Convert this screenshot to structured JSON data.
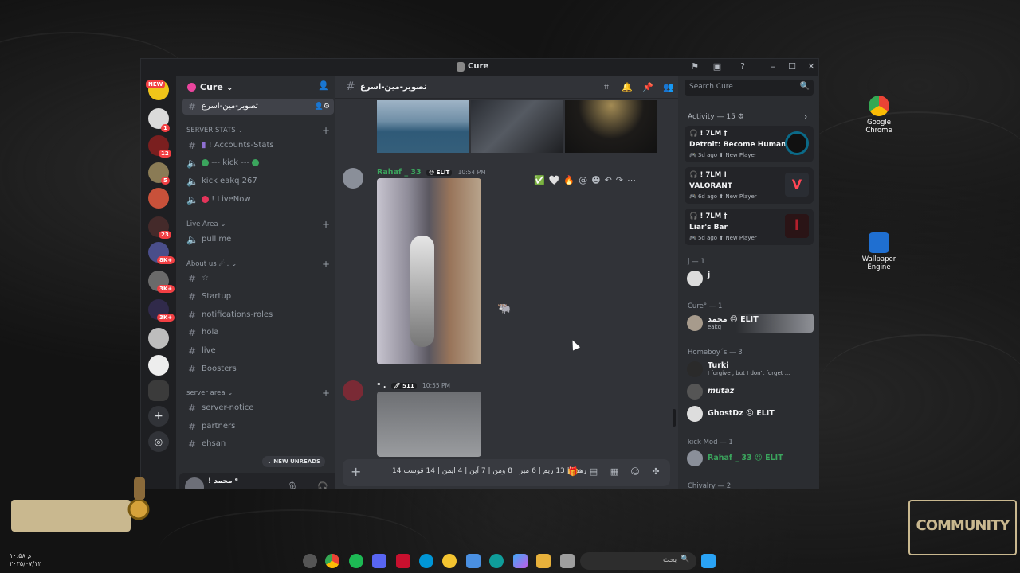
{
  "window": {
    "title": "Cure"
  },
  "guild": {
    "name": "Cure ⌄"
  },
  "rail": {
    "new_badge": "NEW",
    "badges": [
      "1",
      "12",
      "5",
      "23",
      "8K+",
      "3K+",
      "3K+"
    ]
  },
  "channels": {
    "active": "تصوير-مين-اسرع",
    "server_stats_cat": "SERVER STATS ⌄",
    "stats": [
      {
        "icon": "text-icon",
        "label": "! Accounts-Stats"
      },
      {
        "icon": "speaker-icon",
        "label": "--- kick ---"
      },
      {
        "icon": "speaker-icon",
        "label": "kick eakq 267"
      },
      {
        "icon": "speaker-icon",
        "label": "! LiveNow"
      }
    ],
    "live_area_cat": "Live Area ⌄",
    "live": [
      {
        "label": "pull me"
      }
    ],
    "about_cat": "About us ☄ . ⌄",
    "about": [
      "☆",
      "Startup",
      "notifications-roles",
      "hola",
      "live",
      "Boosters"
    ],
    "server_area_cat": "server area ⌄",
    "server_area": [
      "server-notice",
      "partners",
      "ehsan"
    ],
    "new_unreads": "⌄ NEW UNREADS"
  },
  "user_panel": {
    "name": "! محمد ᵉ",
    "status": "eakq"
  },
  "chat": {
    "channel_name": "تصوير-مين-اسرع",
    "msg1": {
      "author": "Rahaf _ 33",
      "tag": "😠 ELIT",
      "time": "10:54 PM"
    },
    "msg2": {
      "author": "ᵉ .",
      "tag": "🖊 511",
      "time": "10:55 PM"
    },
    "toolbar": [
      "✅",
      "🤍",
      "🔥",
      "@",
      "☻",
      "↶",
      "↷",
      "⋯"
    ],
    "composer_text": "14 رهف | 13 ريم | 6 ميز | 8 ومن | 7 آين | 4 ايمن | 14 قوست"
  },
  "right": {
    "search_placeholder": "Search Cure",
    "activity_head": "Activity — 15 ⚙",
    "activities": [
      {
        "who": "🎧 ! 7LM †",
        "game": "Detroit: Become Human",
        "meta": "🎮 3d ago  ⬆ New Player",
        "color": "#0b6a88"
      },
      {
        "who": "🎧 ! 7LM †",
        "game": "VALORANT",
        "meta": "🎮 6d ago  ⬆ New Player",
        "color": "#ff4655"
      },
      {
        "who": "🎧 ! 7LM †",
        "game": "Liar's Bar",
        "meta": "🎮 5d ago  ⬆ New Player",
        "color": "#b51f2c"
      }
    ],
    "groups": [
      {
        "label": "j — 1",
        "members": [
          {
            "name": "j",
            "sub": ""
          }
        ]
      },
      {
        "label": "Cure° — 1",
        "members": [
          {
            "name": "محمد 😠 ELIT",
            "sub": "eakq"
          }
        ]
      },
      {
        "label": "Homeboy´s — 3",
        "members": [
          {
            "name": "Turki",
            "sub": "I forgive , but I don't forget ..."
          },
          {
            "name": "mutaz",
            "sub": ""
          },
          {
            "name": "GhostDz 😠 ELIT",
            "sub": ""
          }
        ]
      },
      {
        "label": "kick Mod — 1",
        "members": [
          {
            "name": "Rahaf _ 33 😠 ELIT",
            "sub": ""
          }
        ]
      },
      {
        "label": "Chivalry — 2",
        "members": []
      }
    ]
  },
  "desktop": {
    "icons": [
      {
        "label": "Google Chrome"
      },
      {
        "label": "Wallpaper Engine"
      }
    ],
    "taskbar_search": "بحث",
    "date_stamp": "م ۱۰:۵۸\n۲۰۲۵/۰۷/۱۲",
    "logo_right": "COMMUNITY"
  },
  "colors": {
    "accent": "#5865f2",
    "green_name": "#3ba55d",
    "bg": "#313338"
  }
}
